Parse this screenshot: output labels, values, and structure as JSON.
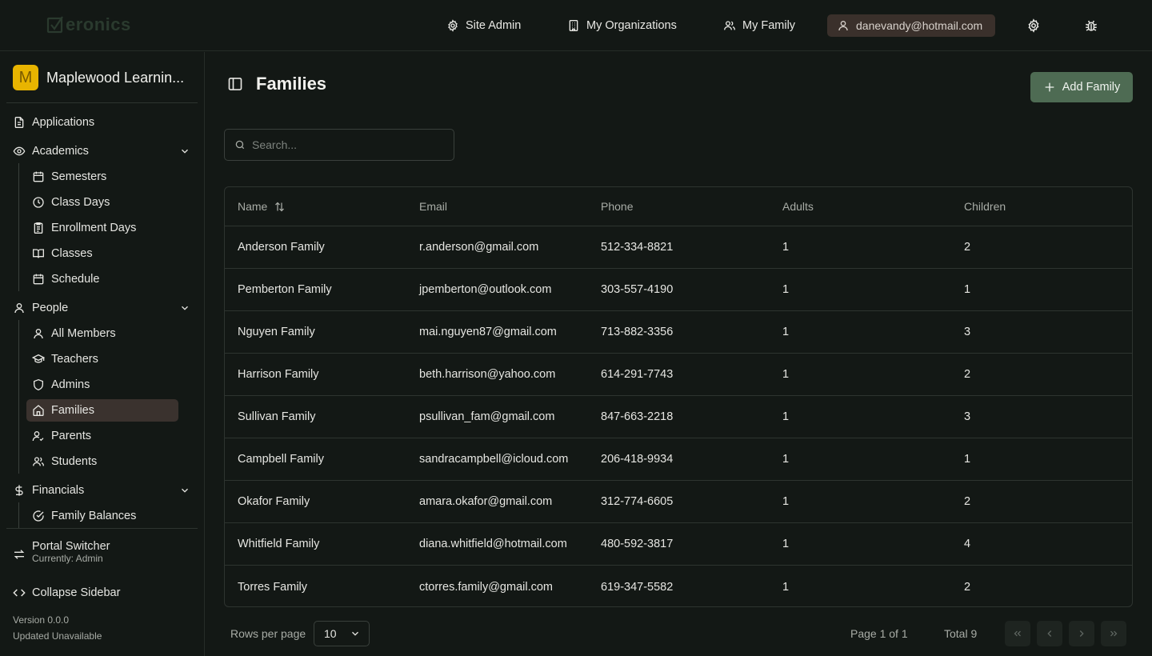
{
  "app": {
    "logo_text": "eronics",
    "top_nav": {
      "site_admin": "Site Admin",
      "my_organizations": "My Organizations",
      "my_family": "My Family",
      "user_email": "danevandy@hotmail.com"
    }
  },
  "sidebar": {
    "org_initial": "M",
    "org_name": "Maplewood Learnin...",
    "applications": "Applications",
    "academics": {
      "label": "Academics",
      "items": [
        "Semesters",
        "Class Days",
        "Enrollment Days",
        "Classes",
        "Schedule"
      ]
    },
    "people": {
      "label": "People",
      "items": [
        "All Members",
        "Teachers",
        "Admins",
        "Families",
        "Parents",
        "Students"
      ],
      "active": "Families"
    },
    "financials": {
      "label": "Financials",
      "items": [
        "Family Balances"
      ]
    },
    "portal_switcher": "Portal Switcher",
    "portal_current": "Currently: Admin",
    "collapse": "Collapse Sidebar",
    "version": "Version 0.0.0",
    "updated": "Updated Unavailable"
  },
  "main": {
    "title": "Families",
    "add_button": "Add Family",
    "search_placeholder": "Search...",
    "columns": [
      "Name",
      "Email",
      "Phone",
      "Adults",
      "Children"
    ],
    "rows": [
      [
        "Anderson Family",
        "r.anderson@gmail.com",
        "512-334-8821",
        "1",
        "2"
      ],
      [
        "Pemberton Family",
        "jpemberton@outlook.com",
        "303-557-4190",
        "1",
        "1"
      ],
      [
        "Nguyen Family",
        "mai.nguyen87@gmail.com",
        "713-882-3356",
        "1",
        "3"
      ],
      [
        "Harrison Family",
        "beth.harrison@yahoo.com",
        "614-291-7743",
        "1",
        "2"
      ],
      [
        "Sullivan Family",
        "psullivan_fam@gmail.com",
        "847-663-2218",
        "1",
        "3"
      ],
      [
        "Campbell Family",
        "sandracampbell@icloud.com",
        "206-418-9934",
        "1",
        "1"
      ],
      [
        "Okafor Family",
        "amara.okafor@gmail.com",
        "312-774-6605",
        "1",
        "2"
      ],
      [
        "Whitfield Family",
        "diana.whitfield@hotmail.com",
        "480-592-3817",
        "1",
        "4"
      ],
      [
        "Torres Family",
        "ctorres.family@gmail.com",
        "619-347-5582",
        "1",
        "2"
      ]
    ],
    "footer": {
      "rows_per_page_label": "Rows per page",
      "rows_per_page_value": "10",
      "page_info": "Page 1 of 1",
      "total": "Total 9"
    }
  },
  "colors": {
    "background": "#131815",
    "accent_button": "#4e6b53",
    "active_item": "#3a322e",
    "org_badge": "#e8b400"
  }
}
